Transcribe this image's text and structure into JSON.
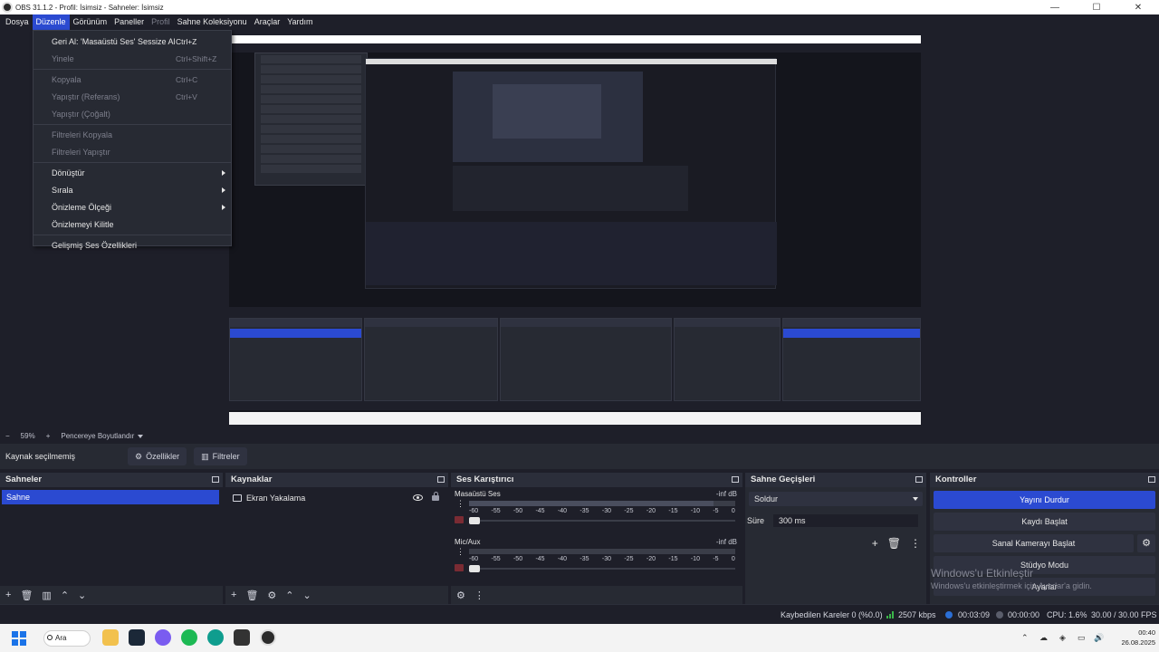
{
  "window": {
    "title": "OBS 31.1.2 - Profil: İsimsiz - Sahneler: İsimsiz",
    "controls": [
      "—",
      "☐",
      "✕"
    ]
  },
  "menubar": [
    {
      "label": "Dosya",
      "state": "normal"
    },
    {
      "label": "Düzenle",
      "state": "active"
    },
    {
      "label": "Görünüm",
      "state": "normal"
    },
    {
      "label": "Paneller",
      "state": "normal"
    },
    {
      "label": "Profil",
      "state": "disabled"
    },
    {
      "label": "Sahne Koleksiyonu",
      "state": "normal"
    },
    {
      "label": "Araçlar",
      "state": "normal"
    },
    {
      "label": "Yardım",
      "state": "normal"
    }
  ],
  "edit_menu": {
    "items": [
      {
        "label": "Geri Al: 'Masaüstü Ses' Sessize Al",
        "shortcut": "Ctrl+Z",
        "enabled": true
      },
      {
        "label": "Yinele",
        "shortcut": "Ctrl+Shift+Z",
        "enabled": false
      },
      {
        "separator": true
      },
      {
        "label": "Kopyala",
        "shortcut": "Ctrl+C",
        "enabled": false
      },
      {
        "label": "Yapıştır (Referans)",
        "shortcut": "Ctrl+V",
        "enabled": false
      },
      {
        "label": "Yapıştır (Çoğalt)",
        "shortcut": "",
        "enabled": false
      },
      {
        "separator": true
      },
      {
        "label": "Filtreleri Kopyala",
        "shortcut": "",
        "enabled": false
      },
      {
        "label": "Filtreleri Yapıştır",
        "shortcut": "",
        "enabled": false
      },
      {
        "separator": true
      },
      {
        "label": "Dönüştür",
        "submenu": true,
        "enabled": true
      },
      {
        "label": "Sırala",
        "submenu": true,
        "enabled": true
      },
      {
        "label": "Önizleme Ölçeği",
        "submenu": true,
        "enabled": true
      },
      {
        "label": "Önizlemeyi Kilitle",
        "enabled": true
      },
      {
        "separator": true
      },
      {
        "label": "Gelişmiş Ses Özellikleri",
        "enabled": true
      }
    ]
  },
  "preview_bar": {
    "zoom": "59%",
    "mode": "Pencereye Boyutlandır"
  },
  "context_bar": {
    "no_source": "Kaynak seçilmemiş",
    "properties": "Özellikler",
    "filters": "Filtreler"
  },
  "docks": {
    "scenes": {
      "title": "Sahneler",
      "items": [
        "Sahne"
      ]
    },
    "sources": {
      "title": "Kaynaklar",
      "items": [
        {
          "name": "Ekran Yakalama"
        }
      ]
    },
    "mixer": {
      "title": "Ses Karıştırıcı",
      "scale": [
        "-60",
        "-55",
        "-50",
        "-45",
        "-40",
        "-35",
        "-30",
        "-25",
        "-20",
        "-15",
        "-10",
        "-5",
        "0"
      ],
      "channels": [
        {
          "name": "Masaüstü Ses",
          "db": "-inf dB",
          "volume": 0.02
        },
        {
          "name": "Mic/Aux",
          "db": "-inf dB",
          "volume": 0.02
        }
      ]
    },
    "transitions": {
      "title": "Sahne Geçişleri",
      "selected": "Soldur",
      "duration_label": "Süre",
      "duration_value": "300 ms"
    },
    "controls": {
      "title": "Kontroller",
      "buttons": [
        "Yayını Durdur",
        "Kaydı Başlat",
        "Sanal Kamerayı Başlat",
        "Stüdyo Modu",
        "Ayarlar"
      ]
    }
  },
  "activation_watermark": {
    "line1": "Windows'u Etkinleştir",
    "line2": "Windows'u etkinleştirmek için Ayarlar'a gidin."
  },
  "status": {
    "dropped": "Kaybedilen Kareler 0 (%0.0)",
    "bitrate": "2507 kbps",
    "stream_time": "00:03:09",
    "rec_time": "00:00:00",
    "cpu": "CPU: 1.6%",
    "fps": "30.00 / 30.00 FPS"
  },
  "taskbar": {
    "search": "Ara",
    "time": "00:40",
    "date": "26.08.2025"
  }
}
